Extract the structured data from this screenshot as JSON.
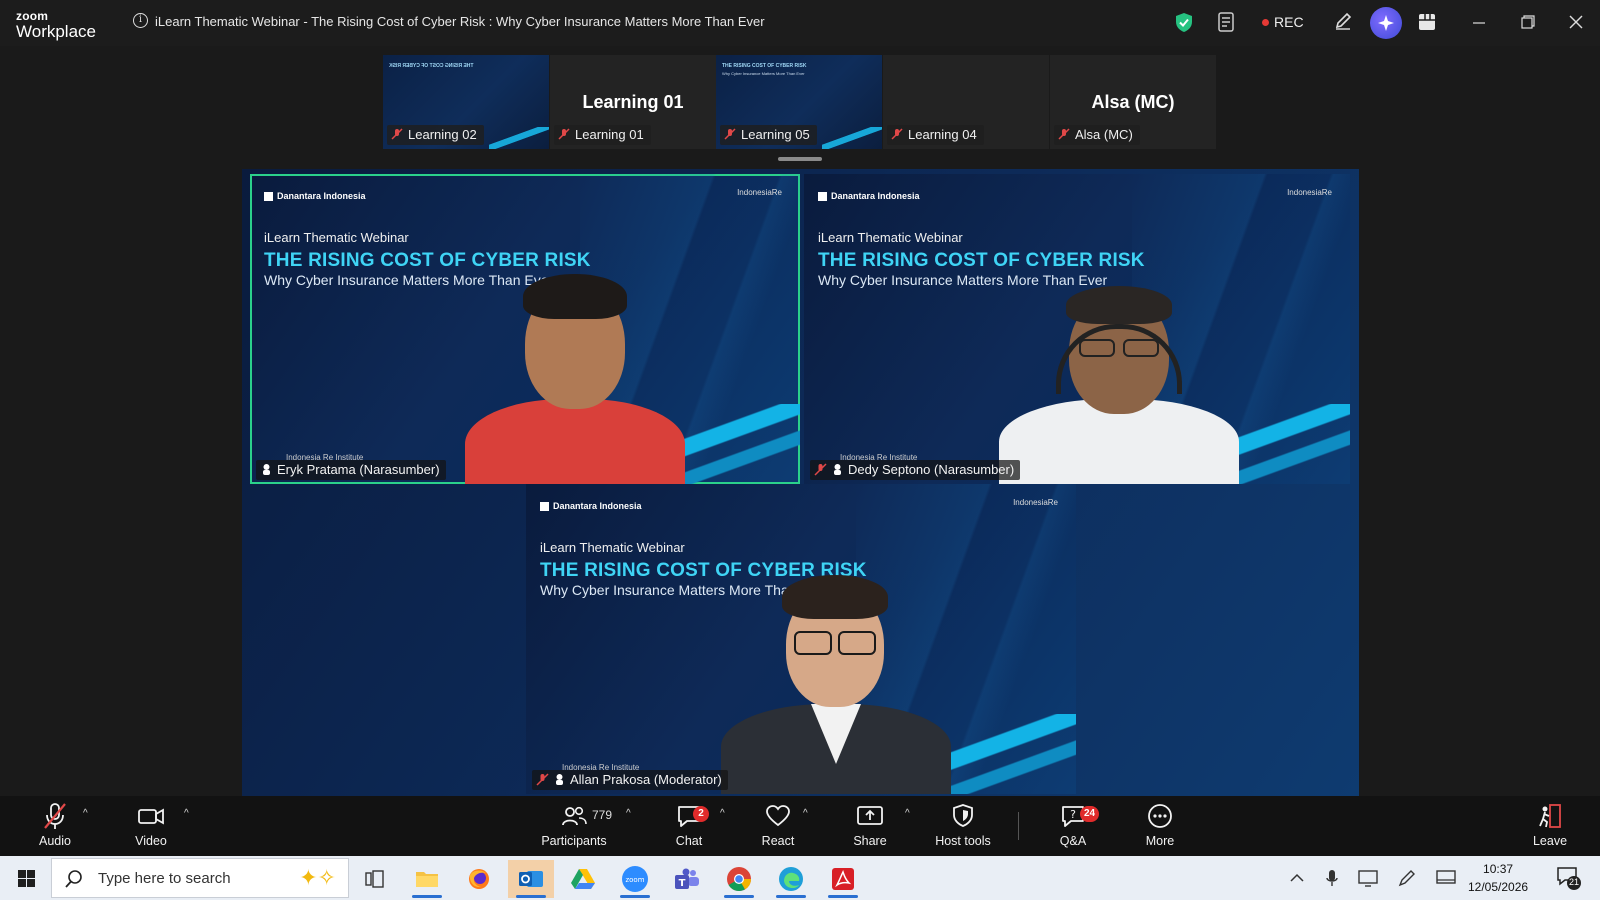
{
  "app": {
    "logo_top": "zoom",
    "logo_bottom": "Workplace"
  },
  "meeting": {
    "title": "iLearn Thematic Webinar - The Rising Cost of Cyber Risk : Why Cyber Insurance Matters More Than Ever"
  },
  "titlebar": {
    "rec_label": "REC"
  },
  "thumbnails": [
    {
      "name": "Learning 02",
      "kind": "slide",
      "big": ""
    },
    {
      "name": "Learning 01",
      "kind": "name",
      "big": "Learning 01"
    },
    {
      "name": "Learning 05",
      "kind": "slide",
      "big": ""
    },
    {
      "name": "Learning 04",
      "kind": "blank",
      "big": ""
    },
    {
      "name": "Alsa (MC)",
      "kind": "name",
      "big": "Alsa (MC)"
    }
  ],
  "slide": {
    "brand_left": "Danantara Indonesia",
    "brand_right": "IndonesiaRe",
    "kicker": "iLearn Thematic Webinar",
    "headline": "THE RISING COST OF CYBER RISK",
    "subline": "Why Cyber Insurance Matters More Than Ever",
    "institute": "Indonesia Re Institute"
  },
  "videos": [
    {
      "name": "Eryk Pratama (Narasumber)"
    },
    {
      "name": "Dedy Septono (Narasumber)"
    },
    {
      "name": "Allan Prakosa (Moderator)"
    }
  ],
  "toolbar": {
    "audio": "Audio",
    "video": "Video",
    "participants": "Participants",
    "participants_count": "779",
    "chat": "Chat",
    "chat_badge": "2",
    "react": "React",
    "share": "Share",
    "host_tools": "Host tools",
    "qa": "Q&A",
    "qa_badge": "24",
    "more": "More",
    "leave": "Leave"
  },
  "taskbar": {
    "search_placeholder": "Type here to search",
    "time": "10:37",
    "date": "12/05/2026",
    "notif_count": "21"
  },
  "colors": {
    "active_speaker": "#2bd18b",
    "headline": "#3fd4f5",
    "rec_dot": "#e53935",
    "badge": "#e02b2b"
  }
}
